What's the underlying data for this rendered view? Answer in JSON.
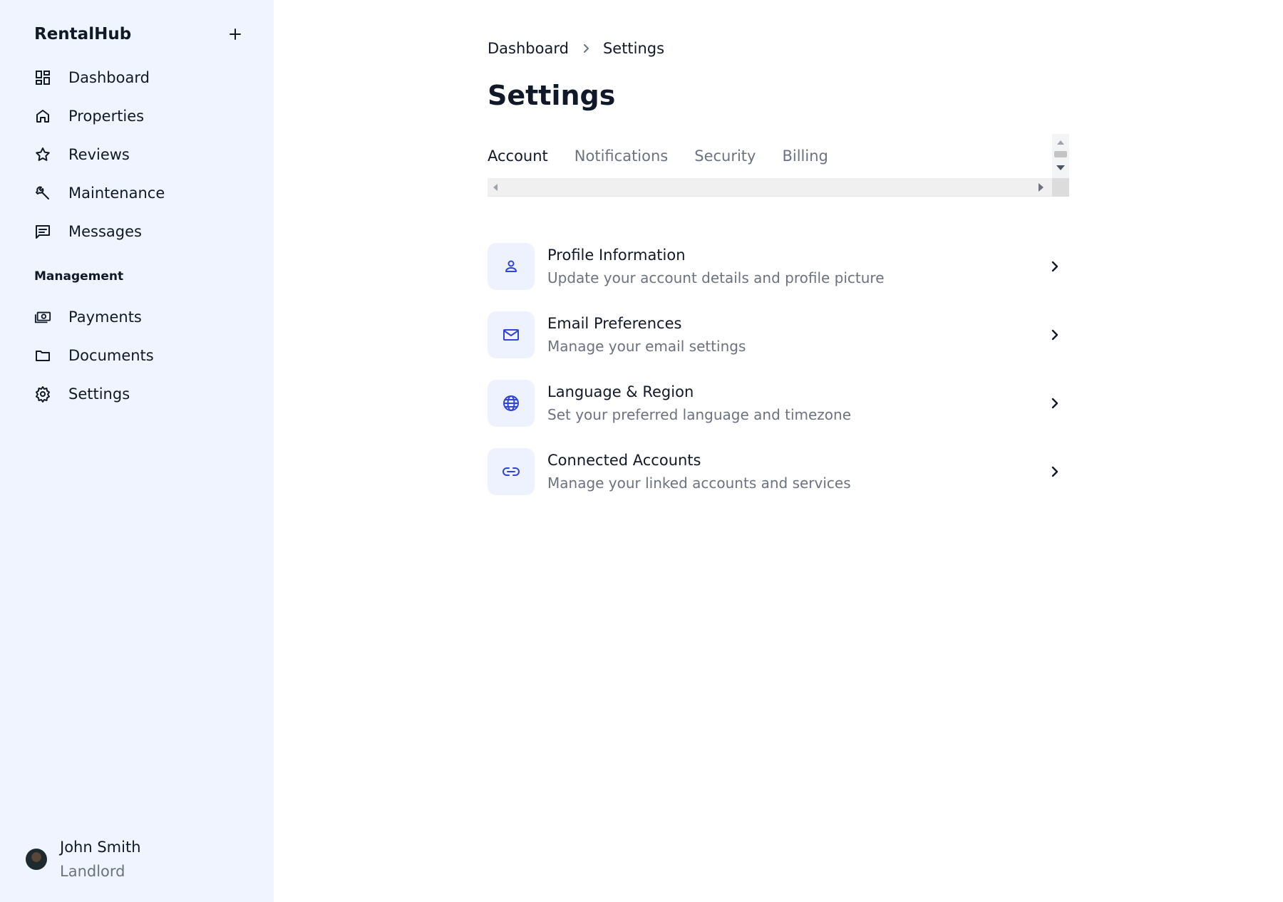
{
  "app": {
    "name": "RentalHub"
  },
  "colors": {
    "sidebar_bg": "#f0f4ff",
    "accent": "#2f45d8",
    "text": "#111827",
    "muted": "#6b7280",
    "icon_tile_bg": "#eef2ff"
  },
  "sidebar": {
    "add_icon": "plus-icon",
    "items": [
      {
        "label": "Dashboard",
        "icon": "dashboard-icon"
      },
      {
        "label": "Properties",
        "icon": "home-icon"
      },
      {
        "label": "Reviews",
        "icon": "star-icon"
      },
      {
        "label": "Maintenance",
        "icon": "wrench-icon"
      },
      {
        "label": "Messages",
        "icon": "message-icon"
      }
    ],
    "section_label": "Management",
    "management_items": [
      {
        "label": "Payments",
        "icon": "money-icon"
      },
      {
        "label": "Documents",
        "icon": "folder-icon"
      },
      {
        "label": "Settings",
        "icon": "gear-icon"
      }
    ],
    "user": {
      "name": "John Smith",
      "role": "Landlord"
    }
  },
  "breadcrumb": {
    "parent": "Dashboard",
    "current": "Settings"
  },
  "page": {
    "title": "Settings"
  },
  "tabs": [
    {
      "label": "Account",
      "active": true
    },
    {
      "label": "Notifications",
      "active": false
    },
    {
      "label": "Security",
      "active": false
    },
    {
      "label": "Billing",
      "active": false
    }
  ],
  "settings": [
    {
      "title": "Profile Information",
      "description": "Update your account details and profile picture",
      "icon": "user-icon"
    },
    {
      "title": "Email Preferences",
      "description": "Manage your email settings",
      "icon": "mail-icon"
    },
    {
      "title": "Language & Region",
      "description": "Set your preferred language and timezone",
      "icon": "globe-icon"
    },
    {
      "title": "Connected Accounts",
      "description": "Manage your linked accounts and services",
      "icon": "link-icon"
    }
  ]
}
